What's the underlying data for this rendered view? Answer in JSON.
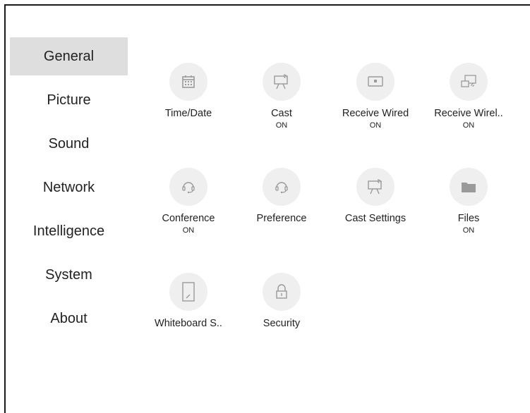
{
  "sidebar": {
    "items": [
      {
        "label": "General"
      },
      {
        "label": "Picture"
      },
      {
        "label": "Sound"
      },
      {
        "label": "Network"
      },
      {
        "label": "Intelligence"
      },
      {
        "label": "System"
      },
      {
        "label": "About"
      }
    ],
    "active": "General"
  },
  "tiles": [
    {
      "label": "Time/Date",
      "status": "",
      "icon": "calendar-icon"
    },
    {
      "label": "Cast",
      "status": "ON",
      "icon": "cast-icon"
    },
    {
      "label": "Receive Wired",
      "status": "ON",
      "icon": "receive-wired-icon"
    },
    {
      "label": "Receive Wirel..",
      "status": "ON",
      "icon": "receive-wireless-icon"
    },
    {
      "label": "Conference",
      "status": "ON",
      "icon": "headset-icon"
    },
    {
      "label": "Preference",
      "status": "",
      "icon": "headset-icon"
    },
    {
      "label": "Cast Settings",
      "status": "",
      "icon": "cast-settings-icon"
    },
    {
      "label": "Files",
      "status": "ON",
      "icon": "folder-icon"
    },
    {
      "label": "Whiteboard S..",
      "status": "",
      "icon": "whiteboard-icon"
    },
    {
      "label": "Security",
      "status": "",
      "icon": "lock-icon"
    }
  ],
  "colors": {
    "active_bg": "#dedede",
    "icon_bg": "#efefef",
    "icon_stroke": "#9a9a9a"
  }
}
